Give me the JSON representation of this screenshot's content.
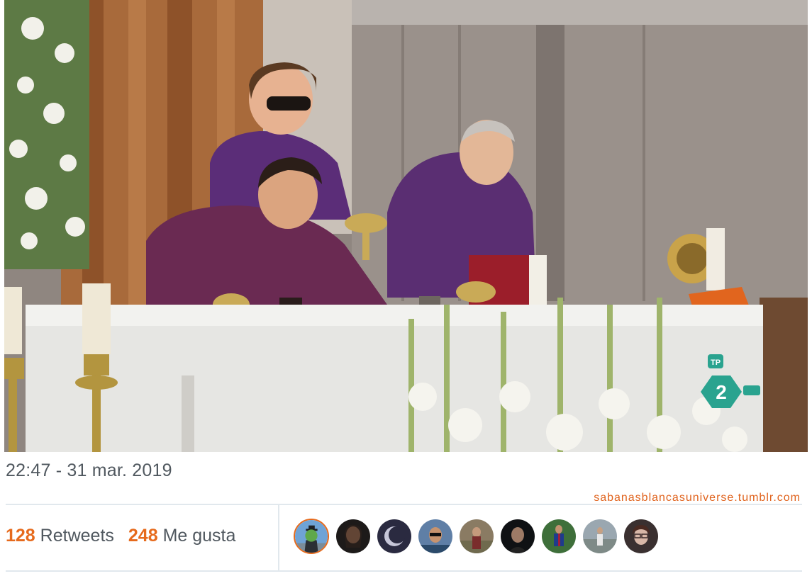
{
  "tweet": {
    "timestamp": "22:47 - 31 mar. 2019",
    "watermark": "sabanasblancasuniverse.tumblr.com",
    "retweets_count": "128",
    "retweets_label": "Retweets",
    "likes_count": "248",
    "likes_label": "Me gusta"
  },
  "media": {
    "channel_logo_top": "TP",
    "channel_logo_number": "2"
  },
  "avatars": [
    {
      "name": "avatar-1",
      "icon": "apple-face-painting"
    },
    {
      "name": "avatar-2",
      "icon": "woman-portrait"
    },
    {
      "name": "avatar-3",
      "icon": "moon-dark"
    },
    {
      "name": "avatar-4",
      "icon": "man-sunglasses"
    },
    {
      "name": "avatar-5",
      "icon": "person-outdoors"
    },
    {
      "name": "avatar-6",
      "icon": "person-dark"
    },
    {
      "name": "avatar-7",
      "icon": "football-player"
    },
    {
      "name": "avatar-8",
      "icon": "person-river"
    },
    {
      "name": "avatar-9",
      "icon": "woman-glasses"
    }
  ]
}
